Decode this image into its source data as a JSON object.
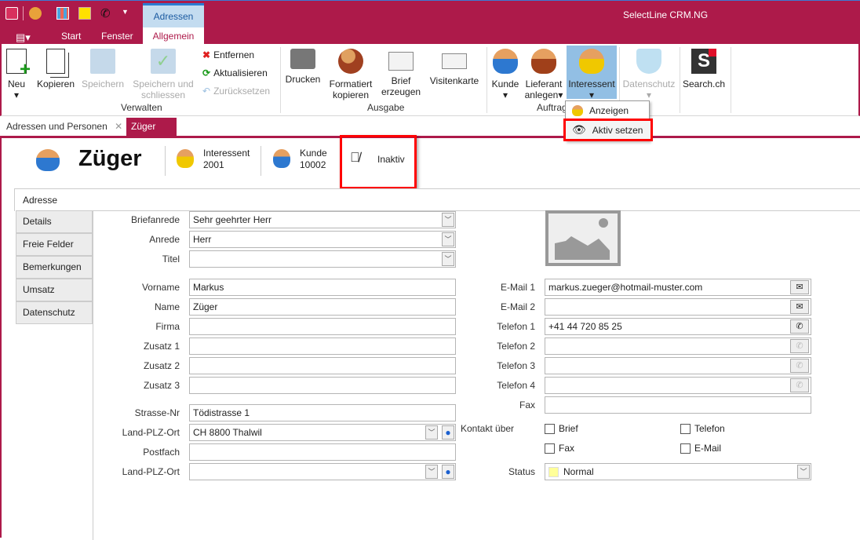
{
  "app": {
    "title": "SelectLine CRM.NG"
  },
  "ribbon": {
    "context_tab": "Adressen",
    "tabs": [
      "Start",
      "Fenster",
      "Allgemein"
    ],
    "active_tab": "Allgemein",
    "buttons": {
      "neu": "Neu",
      "kopieren": "Kopieren",
      "speichern": "Speichern",
      "speichern_schliessen": "Speichern und schliessen",
      "entfernen": "Entfernen",
      "aktualisieren": "Aktualisieren",
      "zuruecksetzen": "Zurücksetzen",
      "drucken": "Drucken",
      "formatiert_kopieren": "Formatiert kopieren",
      "brief_erzeugen": "Brief erzeugen",
      "visitenkarte": "Visitenkarte",
      "kunde": "Kunde",
      "lieferant_anlegen": "Lieferant anlegen",
      "interessent": "Interessent",
      "datenschutz": "Datenschutz",
      "search_ch": "Search.ch"
    },
    "groups": {
      "verwalten": "Verwalten",
      "ausgabe": "Ausgabe",
      "auftrag": "Auftrag"
    },
    "dropdown": {
      "items": [
        "Anzeigen",
        "Aktiv setzen"
      ]
    }
  },
  "doc_tabs": [
    {
      "label": "Adressen und Personen"
    },
    {
      "label": "Züger",
      "active": true
    }
  ],
  "header": {
    "name": "Züger",
    "interessent_label": "Interessent",
    "interessent_nr": "2001",
    "kunde_label": "Kunde",
    "kunde_nr": "10002",
    "status": "Inaktiv"
  },
  "tabs": {
    "active": "Adresse",
    "side": [
      "Details",
      "Freie Felder",
      "Bemerkungen",
      "Umsatz",
      "Datenschutz"
    ]
  },
  "form": {
    "left": [
      {
        "label": "Briefanrede",
        "value": "Sehr geehrter Herr",
        "type": "select"
      },
      {
        "label": "Anrede",
        "value": "Herr",
        "type": "select"
      },
      {
        "label": "Titel",
        "value": "",
        "type": "select"
      },
      {
        "label": "Vorname",
        "value": "Markus"
      },
      {
        "label": "Name",
        "value": "Züger"
      },
      {
        "label": "Firma",
        "value": ""
      },
      {
        "label": "Zusatz 1",
        "value": ""
      },
      {
        "label": "Zusatz 2",
        "value": ""
      },
      {
        "label": "Zusatz 3",
        "value": ""
      },
      {
        "label": "Strasse-Nr",
        "value": "Tödistrasse 1"
      },
      {
        "label": "Land-PLZ-Ort",
        "value": "CH 8800 Thalwil",
        "type": "select-map"
      },
      {
        "label": "Postfach",
        "value": ""
      },
      {
        "label": "Land-PLZ-Ort",
        "value": "",
        "type": "select-map"
      }
    ],
    "right": [
      {
        "label": "E-Mail 1",
        "value": "markus.zueger@hotmail-muster.com",
        "btn": "email"
      },
      {
        "label": "E-Mail 2",
        "value": "",
        "btn": "email"
      },
      {
        "label": "Telefon 1",
        "value": "+41 44 720 85 25",
        "btn": "phone"
      },
      {
        "label": "Telefon 2",
        "value": "",
        "btn": "phone-dis"
      },
      {
        "label": "Telefon 3",
        "value": "",
        "btn": "phone-dis"
      },
      {
        "label": "Telefon 4",
        "value": "",
        "btn": "phone-dis"
      },
      {
        "label": "Fax",
        "value": ""
      }
    ],
    "kontakt": {
      "label": "Kontakt über",
      "options": [
        {
          "label": "Brief",
          "checked": false
        },
        {
          "label": "Telefon",
          "checked": false
        },
        {
          "label": "Fax",
          "checked": false
        },
        {
          "label": "E-Mail",
          "checked": false
        }
      ]
    },
    "status": {
      "label": "Status",
      "value": "Normal",
      "color": "#ffff99"
    }
  },
  "colors": {
    "brand": "#ad1a4a",
    "context_tab": "#c3dcf0",
    "highlight": "#ff0000"
  }
}
